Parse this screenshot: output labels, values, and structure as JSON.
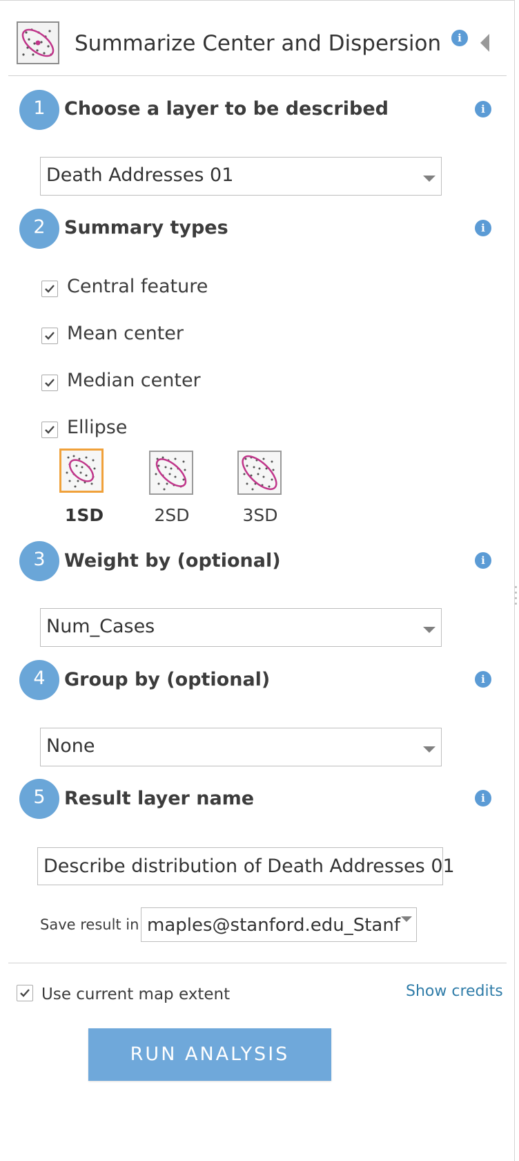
{
  "header": {
    "title": "Summarize Center and Dispersion",
    "info_icon": "info-icon",
    "collapse_icon": "collapse-left-icon",
    "tool_icon": "ellipse-dispersion-icon"
  },
  "steps": [
    {
      "number": "1",
      "title": "Choose a layer to be described",
      "select_value": "Death Addresses 01"
    },
    {
      "number": "2",
      "title": "Summary types"
    },
    {
      "number": "3",
      "title": "Weight by (optional)",
      "select_value": "Num_Cases"
    },
    {
      "number": "4",
      "title": "Group by (optional)",
      "select_value": "None"
    },
    {
      "number": "5",
      "title": "Result layer name",
      "input_value": "Describe distribution of Death Addresses 01"
    }
  ],
  "summary_types": [
    {
      "label": "Central feature",
      "checked": true
    },
    {
      "label": "Mean center",
      "checked": true
    },
    {
      "label": "Median center",
      "checked": true
    },
    {
      "label": "Ellipse",
      "checked": true
    }
  ],
  "ellipse_options": [
    {
      "label": "1SD",
      "selected": true
    },
    {
      "label": "2SD",
      "selected": false
    },
    {
      "label": "3SD",
      "selected": false
    }
  ],
  "save": {
    "label": "Save result in",
    "value": "maples@stanford.edu_Stanf"
  },
  "footer": {
    "extent_label": "Use current map extent",
    "extent_checked": true,
    "credits_link": "Show credits",
    "run_button": "RUN ANALYSIS"
  },
  "colors": {
    "accent_blue": "#6aa6d8",
    "button_blue": "#6fa8da",
    "ellipse_pink": "#c0358a",
    "selected_orange": "#f0a13a",
    "link_blue": "#2f7ca8"
  }
}
